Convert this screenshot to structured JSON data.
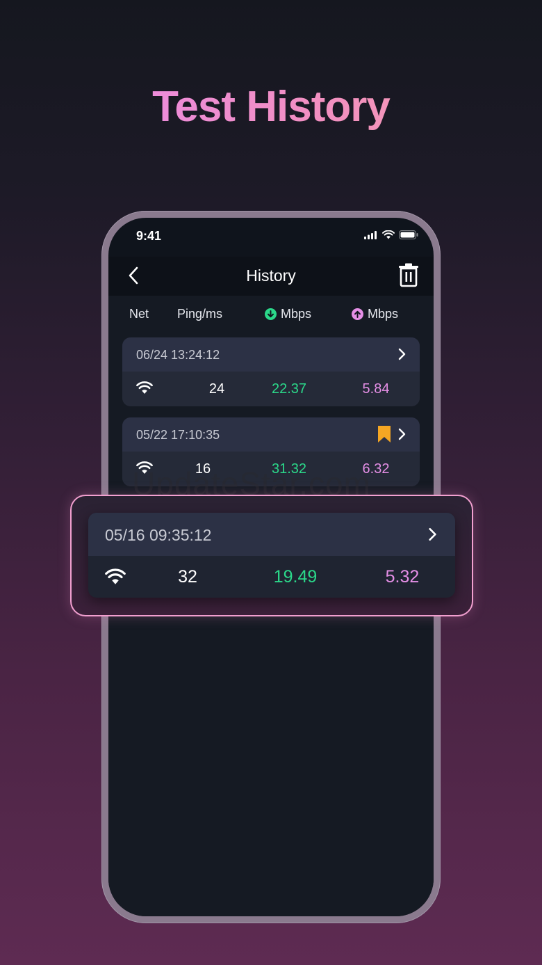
{
  "hero": {
    "title": "Test History"
  },
  "status_bar": {
    "time": "9:41"
  },
  "nav": {
    "title": "History"
  },
  "columns": {
    "net": "Net",
    "ping": "Ping/ms",
    "download": "Mbps",
    "upload": "Mbps"
  },
  "records": [
    {
      "date": "06/24 13:24:12",
      "ping": "24",
      "download": "22.37",
      "upload": "5.84",
      "bookmarked": false
    },
    {
      "date": "05/22 17:10:35",
      "ping": "16",
      "download": "31.32",
      "upload": "6.32",
      "bookmarked": true
    }
  ],
  "highlighted_record": {
    "date": "05/16 09:35:12",
    "ping": "32",
    "download": "19.49",
    "upload": "5.32"
  },
  "watermark": "UpdateStar.com",
  "colors": {
    "download": "#2bd88a",
    "upload": "#e58fe6",
    "bookmark": "#f5a623",
    "highlight_border": "#f2a0d0"
  },
  "icons": {
    "back": "chevron-left-icon",
    "delete": "trash-icon",
    "net": "wifi-icon",
    "download": "arrow-down-circle-icon",
    "upload": "arrow-up-circle-icon",
    "bookmark": "bookmark-icon",
    "detail": "chevron-right-icon"
  }
}
